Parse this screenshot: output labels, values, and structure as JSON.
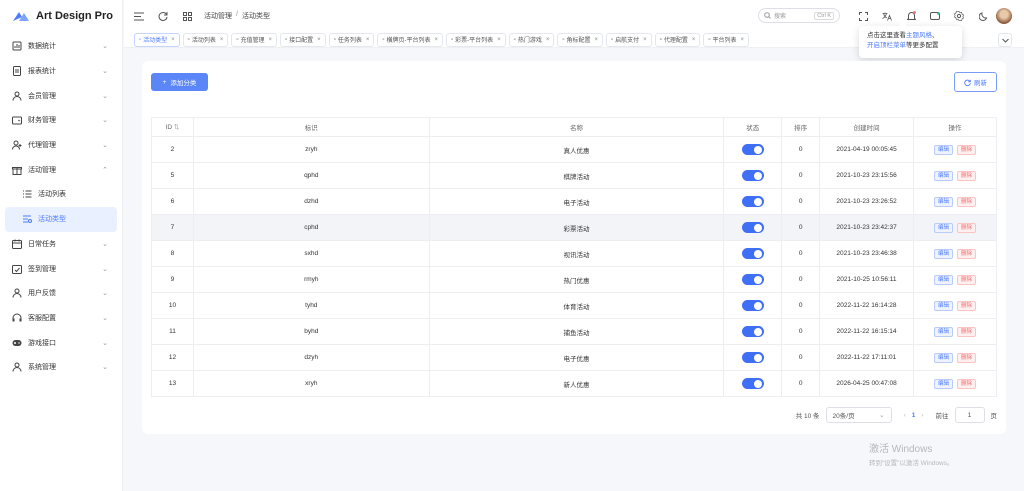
{
  "app": {
    "title": "Art Design Pro",
    "accent": "#4d7cfe"
  },
  "sidebar": {
    "items": [
      {
        "label": "数据统计",
        "icon": "chart-icon",
        "expand": "⌄"
      },
      {
        "label": "报表统计",
        "icon": "report-icon",
        "expand": "⌄"
      },
      {
        "label": "会员管理",
        "icon": "user-icon",
        "expand": "⌄"
      },
      {
        "label": "财务管理",
        "icon": "wallet-icon",
        "expand": "⌄"
      },
      {
        "label": "代理管理",
        "icon": "agent-icon",
        "expand": "⌄"
      },
      {
        "label": "活动管理",
        "icon": "gift-icon",
        "expand": "⌃"
      },
      {
        "label": "活动列表",
        "icon": "list-icon",
        "expand": ""
      },
      {
        "label": "活动类型",
        "icon": "type-icon",
        "expand": ""
      },
      {
        "label": "日常任务",
        "icon": "calendar-icon",
        "expand": "⌄"
      },
      {
        "label": "签到管理",
        "icon": "checkin-icon",
        "expand": "⌄"
      },
      {
        "label": "用户反馈",
        "icon": "feedback-icon",
        "expand": "⌄"
      },
      {
        "label": "客服配置",
        "icon": "headset-icon",
        "expand": "⌄"
      },
      {
        "label": "游戏接口",
        "icon": "game-icon",
        "expand": "⌄"
      },
      {
        "label": "系统管理",
        "icon": "system-icon",
        "expand": "⌄"
      }
    ]
  },
  "header": {
    "breadcrumb": [
      "活动管理",
      "活动类型"
    ],
    "breadcrumb_sep": "/",
    "search_placeholder": "搜索",
    "search_kbd": "Ctrl K"
  },
  "tabs": [
    "活动类型",
    "活动列表",
    "充值管理",
    "接口配置",
    "任务列表",
    "横牌页-平台列表",
    "彩票-平台列表",
    "热门游戏",
    "角标配置",
    "启航支付",
    "代理配置",
    "平台列表"
  ],
  "tooltip": {
    "p1": "点击这里查看",
    "h1": "主题风格",
    "p2": "、",
    "h2": "开启顶栏菜单",
    "p3": "等更多配置"
  },
  "toolbar": {
    "add_label": "添加分类",
    "refresh_label": "刷新"
  },
  "table": {
    "headers": [
      "ID",
      "标识",
      "名称",
      "状态",
      "排序",
      "创建时间",
      "操作"
    ],
    "edit_label": "编辑",
    "delete_label": "删除",
    "rows": [
      {
        "id": "2",
        "code": "zryh",
        "name": "真人优惠",
        "sort": "0",
        "time": "2021-04-19 00:05:45",
        "enabled": true
      },
      {
        "id": "5",
        "code": "qphd",
        "name": "棋牌活动",
        "sort": "0",
        "time": "2021-10-23 23:15:56",
        "enabled": true
      },
      {
        "id": "6",
        "code": "dzhd",
        "name": "电子活动",
        "sort": "0",
        "time": "2021-10-23 23:26:52",
        "enabled": true
      },
      {
        "id": "7",
        "code": "cphd",
        "name": "彩票活动",
        "sort": "0",
        "time": "2021-10-23 23:42:37",
        "enabled": true
      },
      {
        "id": "8",
        "code": "sxhd",
        "name": "视讯活动",
        "sort": "0",
        "time": "2021-10-23 23:46:38",
        "enabled": true
      },
      {
        "id": "9",
        "code": "rmyh",
        "name": "热门优惠",
        "sort": "0",
        "time": "2021-10-25 10:56:11",
        "enabled": true
      },
      {
        "id": "10",
        "code": "tyhd",
        "name": "体育活动",
        "sort": "0",
        "time": "2022-11-22 16:14:28",
        "enabled": true
      },
      {
        "id": "11",
        "code": "byhd",
        "name": "捕鱼活动",
        "sort": "0",
        "time": "2022-11-22 16:15:14",
        "enabled": true
      },
      {
        "id": "12",
        "code": "dzyh",
        "name": "电子优惠",
        "sort": "0",
        "time": "2022-11-22 17:11:01",
        "enabled": true
      },
      {
        "id": "13",
        "code": "xryh",
        "name": "新人优惠",
        "sort": "0",
        "time": "2026-04-25 00:47:08",
        "enabled": true
      }
    ]
  },
  "pagination": {
    "total": "共 10 条",
    "page_size": "20条/页",
    "current": "1",
    "goto_label": "前往",
    "goto_value": "1",
    "page_suffix": "页"
  },
  "watermark": {
    "line1": "激活 Windows",
    "line2": "转到“设置”以激活 Windows。"
  }
}
